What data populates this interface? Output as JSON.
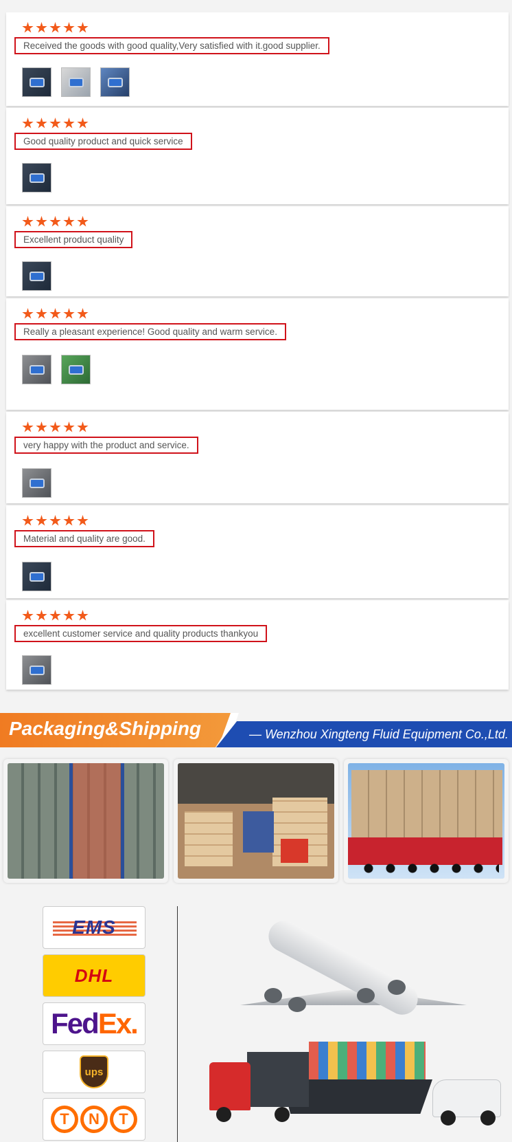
{
  "reviews": [
    {
      "rating": 5,
      "text": "Received the goods with good quality,Very satisfied with it.good supplier.",
      "photos": [
        "dark",
        "light",
        "blue"
      ]
    },
    {
      "rating": 5,
      "text": "Good quality product and quick service",
      "photos": [
        "dark"
      ]
    },
    {
      "rating": 5,
      "text": "Excellent product quality",
      "photos": [
        "dark"
      ]
    },
    {
      "rating": 5,
      "text": "Really a pleasant experience! Good quality and warm service.",
      "photos": [
        "grey",
        "green"
      ]
    },
    {
      "rating": 5,
      "text": "very happy with the product and service.",
      "photos": [
        "grey"
      ]
    },
    {
      "rating": 5,
      "text": "Material and quality are good.",
      "photos": [
        "dark"
      ]
    },
    {
      "rating": 5,
      "text": "excellent customer service and quality products thankyou",
      "photos": [
        "grey"
      ]
    }
  ],
  "banner": {
    "title": "Packaging&Shipping",
    "company": "— Wenzhou Xingteng Fluid Equipment Co.,Ltd."
  },
  "couriers": {
    "ems": "EMS",
    "dhl": "DHL",
    "fedex_fed": "Fed",
    "fedex_ex": "Ex.",
    "ups": "ups",
    "tnt": [
      "T",
      "N",
      "T"
    ]
  },
  "colors": {
    "star": "#f25a1a",
    "review_border": "#d0121a",
    "banner_orange": "#f07b22",
    "banner_blue": "#1e4db2"
  }
}
